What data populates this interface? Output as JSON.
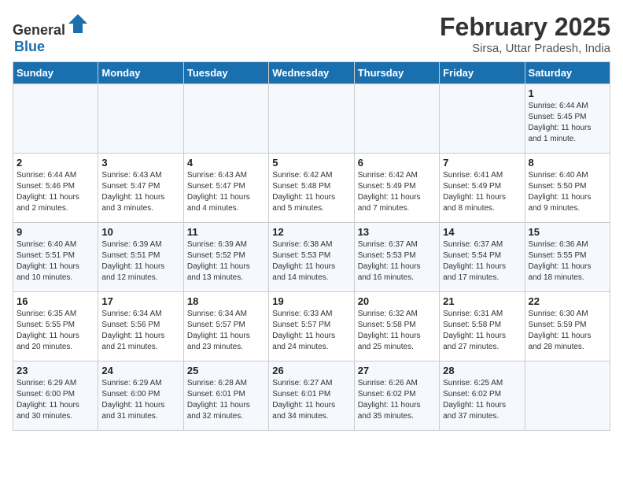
{
  "logo": {
    "general": "General",
    "blue": "Blue"
  },
  "title": "February 2025",
  "location": "Sirsa, Uttar Pradesh, India",
  "days_of_week": [
    "Sunday",
    "Monday",
    "Tuesday",
    "Wednesday",
    "Thursday",
    "Friday",
    "Saturday"
  ],
  "weeks": [
    [
      {
        "day": "",
        "detail": ""
      },
      {
        "day": "",
        "detail": ""
      },
      {
        "day": "",
        "detail": ""
      },
      {
        "day": "",
        "detail": ""
      },
      {
        "day": "",
        "detail": ""
      },
      {
        "day": "",
        "detail": ""
      },
      {
        "day": "1",
        "detail": "Sunrise: 6:44 AM\nSunset: 5:45 PM\nDaylight: 11 hours\nand 1 minute."
      }
    ],
    [
      {
        "day": "2",
        "detail": "Sunrise: 6:44 AM\nSunset: 5:46 PM\nDaylight: 11 hours\nand 2 minutes."
      },
      {
        "day": "3",
        "detail": "Sunrise: 6:43 AM\nSunset: 5:47 PM\nDaylight: 11 hours\nand 3 minutes."
      },
      {
        "day": "4",
        "detail": "Sunrise: 6:43 AM\nSunset: 5:47 PM\nDaylight: 11 hours\nand 4 minutes."
      },
      {
        "day": "5",
        "detail": "Sunrise: 6:42 AM\nSunset: 5:48 PM\nDaylight: 11 hours\nand 5 minutes."
      },
      {
        "day": "6",
        "detail": "Sunrise: 6:42 AM\nSunset: 5:49 PM\nDaylight: 11 hours\nand 7 minutes."
      },
      {
        "day": "7",
        "detail": "Sunrise: 6:41 AM\nSunset: 5:49 PM\nDaylight: 11 hours\nand 8 minutes."
      },
      {
        "day": "8",
        "detail": "Sunrise: 6:40 AM\nSunset: 5:50 PM\nDaylight: 11 hours\nand 9 minutes."
      }
    ],
    [
      {
        "day": "9",
        "detail": "Sunrise: 6:40 AM\nSunset: 5:51 PM\nDaylight: 11 hours\nand 10 minutes."
      },
      {
        "day": "10",
        "detail": "Sunrise: 6:39 AM\nSunset: 5:51 PM\nDaylight: 11 hours\nand 12 minutes."
      },
      {
        "day": "11",
        "detail": "Sunrise: 6:39 AM\nSunset: 5:52 PM\nDaylight: 11 hours\nand 13 minutes."
      },
      {
        "day": "12",
        "detail": "Sunrise: 6:38 AM\nSunset: 5:53 PM\nDaylight: 11 hours\nand 14 minutes."
      },
      {
        "day": "13",
        "detail": "Sunrise: 6:37 AM\nSunset: 5:53 PM\nDaylight: 11 hours\nand 16 minutes."
      },
      {
        "day": "14",
        "detail": "Sunrise: 6:37 AM\nSunset: 5:54 PM\nDaylight: 11 hours\nand 17 minutes."
      },
      {
        "day": "15",
        "detail": "Sunrise: 6:36 AM\nSunset: 5:55 PM\nDaylight: 11 hours\nand 18 minutes."
      }
    ],
    [
      {
        "day": "16",
        "detail": "Sunrise: 6:35 AM\nSunset: 5:55 PM\nDaylight: 11 hours\nand 20 minutes."
      },
      {
        "day": "17",
        "detail": "Sunrise: 6:34 AM\nSunset: 5:56 PM\nDaylight: 11 hours\nand 21 minutes."
      },
      {
        "day": "18",
        "detail": "Sunrise: 6:34 AM\nSunset: 5:57 PM\nDaylight: 11 hours\nand 23 minutes."
      },
      {
        "day": "19",
        "detail": "Sunrise: 6:33 AM\nSunset: 5:57 PM\nDaylight: 11 hours\nand 24 minutes."
      },
      {
        "day": "20",
        "detail": "Sunrise: 6:32 AM\nSunset: 5:58 PM\nDaylight: 11 hours\nand 25 minutes."
      },
      {
        "day": "21",
        "detail": "Sunrise: 6:31 AM\nSunset: 5:58 PM\nDaylight: 11 hours\nand 27 minutes."
      },
      {
        "day": "22",
        "detail": "Sunrise: 6:30 AM\nSunset: 5:59 PM\nDaylight: 11 hours\nand 28 minutes."
      }
    ],
    [
      {
        "day": "23",
        "detail": "Sunrise: 6:29 AM\nSunset: 6:00 PM\nDaylight: 11 hours\nand 30 minutes."
      },
      {
        "day": "24",
        "detail": "Sunrise: 6:29 AM\nSunset: 6:00 PM\nDaylight: 11 hours\nand 31 minutes."
      },
      {
        "day": "25",
        "detail": "Sunrise: 6:28 AM\nSunset: 6:01 PM\nDaylight: 11 hours\nand 32 minutes."
      },
      {
        "day": "26",
        "detail": "Sunrise: 6:27 AM\nSunset: 6:01 PM\nDaylight: 11 hours\nand 34 minutes."
      },
      {
        "day": "27",
        "detail": "Sunrise: 6:26 AM\nSunset: 6:02 PM\nDaylight: 11 hours\nand 35 minutes."
      },
      {
        "day": "28",
        "detail": "Sunrise: 6:25 AM\nSunset: 6:02 PM\nDaylight: 11 hours\nand 37 minutes."
      },
      {
        "day": "",
        "detail": ""
      }
    ]
  ]
}
